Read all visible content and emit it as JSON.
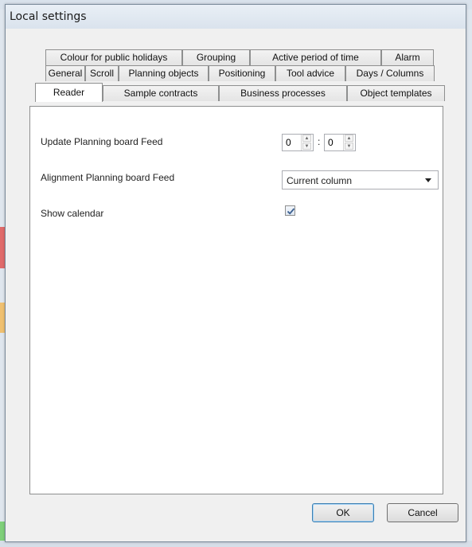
{
  "window": {
    "title": "Local settings"
  },
  "tabs": {
    "row1": [
      "Colour for public holidays",
      "Grouping",
      "Active period of time",
      "Alarm"
    ],
    "row2": [
      "General",
      "Scroll",
      "Planning objects",
      "Positioning",
      "Tool advice",
      "Days / Columns"
    ],
    "row3": [
      "Reader",
      "Sample contracts",
      "Business processes",
      "Object templates"
    ],
    "active": "Reader"
  },
  "settings": {
    "update_feed": {
      "label": "Update Planning board Feed",
      "value_hours": "0",
      "separator": ":",
      "value_minutes": "0"
    },
    "alignment_feed": {
      "label": "Alignment Planning board Feed",
      "value": "Current column"
    },
    "show_calendar": {
      "label": "Show calendar",
      "checked": true
    }
  },
  "buttons": {
    "ok": "OK",
    "cancel": "Cancel"
  }
}
